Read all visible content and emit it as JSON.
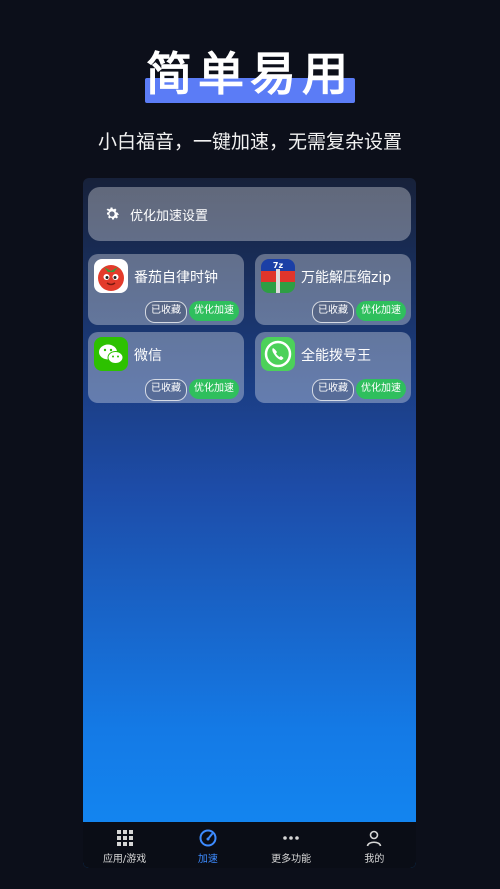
{
  "promo": {
    "headline": "简单易用",
    "subtitle": "小白福音，一键加速，无需复杂设置"
  },
  "settings": {
    "label": "优化加速设置",
    "icon": "gear-icon"
  },
  "apps": [
    {
      "name": "番茄自律时钟",
      "icon": "tomato-app-icon",
      "fav_label": "已收藏",
      "opt_label": "优化加速"
    },
    {
      "name": "万能解压缩zip",
      "icon": "zip-app-icon",
      "fav_label": "已收藏",
      "opt_label": "优化加速"
    },
    {
      "name": "微信",
      "icon": "wechat-app-icon",
      "fav_label": "已收藏",
      "opt_label": "优化加速"
    },
    {
      "name": "全能拨号王",
      "icon": "phone-app-icon",
      "fav_label": "已收藏",
      "opt_label": "优化加速"
    }
  ],
  "tabs": [
    {
      "label": "应用/游戏",
      "icon": "grid-icon",
      "active": false
    },
    {
      "label": "加速",
      "icon": "speedometer-icon",
      "active": true
    },
    {
      "label": "更多功能",
      "icon": "more-dots-icon",
      "active": false
    },
    {
      "label": "我的",
      "icon": "user-icon",
      "active": false
    }
  ],
  "colors": {
    "accent": "#5b7cf6",
    "optimize_button": "#2fbf5d",
    "active_tab": "#3d8bff"
  }
}
